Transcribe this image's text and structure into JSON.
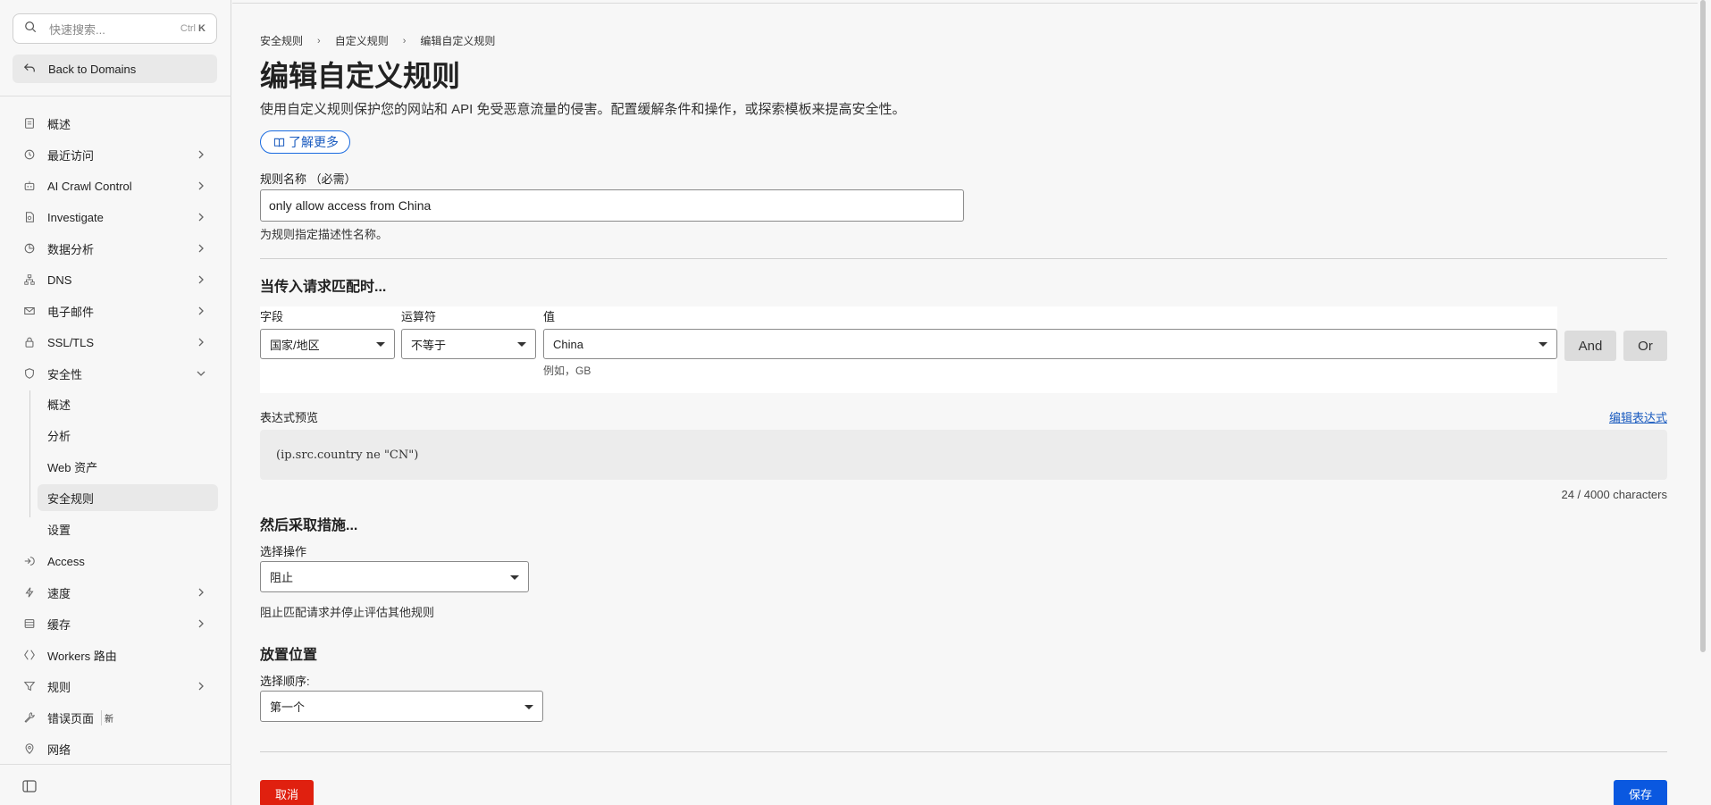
{
  "sidebar": {
    "search": {
      "placeholder": "快速搜索...",
      "shortcut_mod": "Ctrl",
      "shortcut_key": "K"
    },
    "back_label": "Back to Domains",
    "items": [
      {
        "label": "概述",
        "icon": "document-icon"
      },
      {
        "label": "最近访问",
        "icon": "clock-icon",
        "chevron": true
      },
      {
        "label": "AI Crawl Control",
        "icon": "robot-icon",
        "chevron": true
      },
      {
        "label": "Investigate",
        "icon": "magnify-document-icon",
        "chevron": true
      },
      {
        "label": "数据分析",
        "icon": "pie-chart-icon",
        "chevron": true
      },
      {
        "label": "DNS",
        "icon": "network-icon",
        "chevron": true
      },
      {
        "label": "电子邮件",
        "icon": "mail-icon",
        "chevron": true
      },
      {
        "label": "SSL/TLS",
        "icon": "lock-icon",
        "chevron": true
      },
      {
        "label": "安全性",
        "icon": "shield-icon",
        "expanded": true
      }
    ],
    "security_sub": [
      {
        "label": "概述"
      },
      {
        "label": "分析"
      },
      {
        "label": "Web 资产"
      },
      {
        "label": "安全规则",
        "active": true
      },
      {
        "label": "设置"
      }
    ],
    "items_after": [
      {
        "label": "Access",
        "icon": "access-icon"
      },
      {
        "label": "速度",
        "icon": "bolt-icon",
        "chevron": true
      },
      {
        "label": "缓存",
        "icon": "stack-icon",
        "chevron": true
      },
      {
        "label": "Workers 路由",
        "icon": "workers-icon"
      },
      {
        "label": "规则",
        "icon": "funnel-icon",
        "chevron": true
      },
      {
        "label": "错误页面",
        "icon": "wrench-icon",
        "badge": "新"
      },
      {
        "label": "网络",
        "icon": "pin-icon"
      }
    ]
  },
  "breadcrumb": [
    "安全规则",
    "自定义规则",
    "编辑自定义规则"
  ],
  "page": {
    "title": "编辑自定义规则",
    "description": "使用自定义规则保护您的网站和 API 免受恶意流量的侵害。配置缓解条件和操作，或探索模板来提高安全性。",
    "learn_more": "了解更多"
  },
  "rule_name": {
    "label": "规则名称 （必需）",
    "value": "only allow access from China",
    "help": "为规则指定描述性名称。"
  },
  "condition": {
    "heading": "当传入请求匹配时...",
    "field_label": "字段",
    "field_value": "国家/地区",
    "operator_label": "运算符",
    "operator_value": "不等于",
    "value_label": "值",
    "value_value": "China",
    "value_help": "例如，GB",
    "and_label": "And",
    "or_label": "Or"
  },
  "expression": {
    "label": "表达式预览",
    "edit_link": "编辑表达式",
    "text": "(ip.src.country ne \"CN\")",
    "counter": "24 / 4000 characters"
  },
  "action": {
    "heading": "然后采取措施...",
    "label": "选择操作",
    "value": "阻止",
    "help": "阻止匹配请求并停止评估其他规则"
  },
  "placement": {
    "heading": "放置位置",
    "label": "选择顺序:",
    "value": "第一个"
  },
  "footer": {
    "cancel": "取消",
    "save": "保存"
  },
  "colors": {
    "accent": "#0a58e0",
    "danger": "#e0200f",
    "link": "#1a5bbf"
  }
}
